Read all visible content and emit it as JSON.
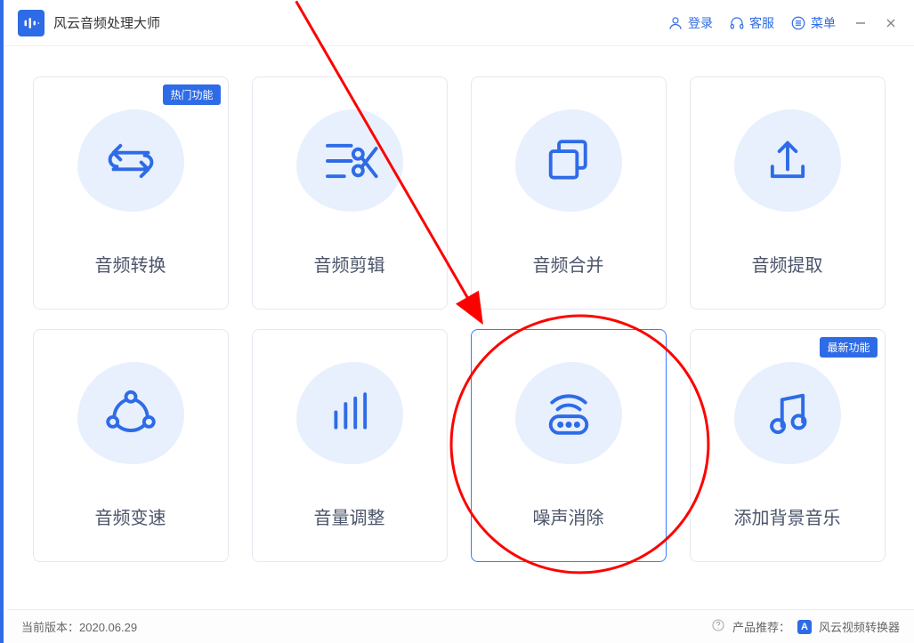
{
  "app": {
    "title": "风云音频处理大师"
  },
  "titlebar": {
    "login": "登录",
    "support": "客服",
    "menu": "菜单"
  },
  "cards": [
    {
      "label": "音频转换",
      "badge": "热门功能"
    },
    {
      "label": "音频剪辑"
    },
    {
      "label": "音频合并"
    },
    {
      "label": "音频提取"
    },
    {
      "label": "音频变速"
    },
    {
      "label": "音量调整"
    },
    {
      "label": "噪声消除"
    },
    {
      "label": "添加背景音乐",
      "badge": "最新功能"
    }
  ],
  "status": {
    "version_label": "当前版本：",
    "version": "2020.06.29",
    "recommend_label": "产品推荐：",
    "recommend_product": "风云视频转换器"
  }
}
